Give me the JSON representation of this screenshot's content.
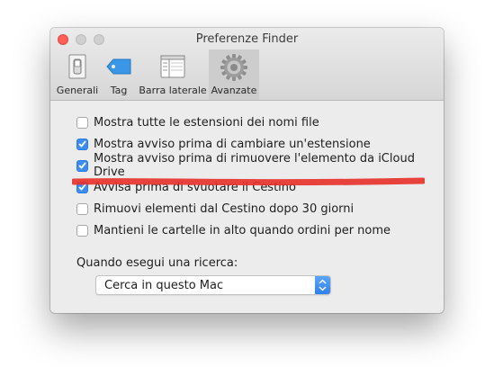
{
  "window": {
    "title": "Preferenze Finder"
  },
  "toolbar": {
    "items": [
      {
        "label": "Generali",
        "icon": "switch-icon"
      },
      {
        "label": "Tag",
        "icon": "tag-icon"
      },
      {
        "label": "Barra laterale",
        "icon": "sidebar-icon"
      },
      {
        "label": "Avanzate",
        "icon": "gear-icon",
        "selected": true
      }
    ]
  },
  "options": [
    {
      "label": "Mostra tutte le estensioni dei nomi file",
      "checked": false
    },
    {
      "label": "Mostra avviso prima di cambiare un'estensione",
      "checked": true
    },
    {
      "label": "Mostra avviso prima di rimuovere l'elemento da iCloud Drive",
      "checked": true
    },
    {
      "label": "Avvisa prima di svuotare il Cestino",
      "checked": true
    },
    {
      "label": "Rimuovi elementi dal Cestino dopo 30 giorni",
      "checked": false
    },
    {
      "label": "Mantieni le cartelle in alto quando ordini per nome",
      "checked": false
    }
  ],
  "search": {
    "label": "Quando esegui una ricerca:",
    "selected": "Cerca in questo Mac"
  },
  "colors": {
    "accent": "#3b8ef6",
    "annotation": "#e8302a"
  }
}
